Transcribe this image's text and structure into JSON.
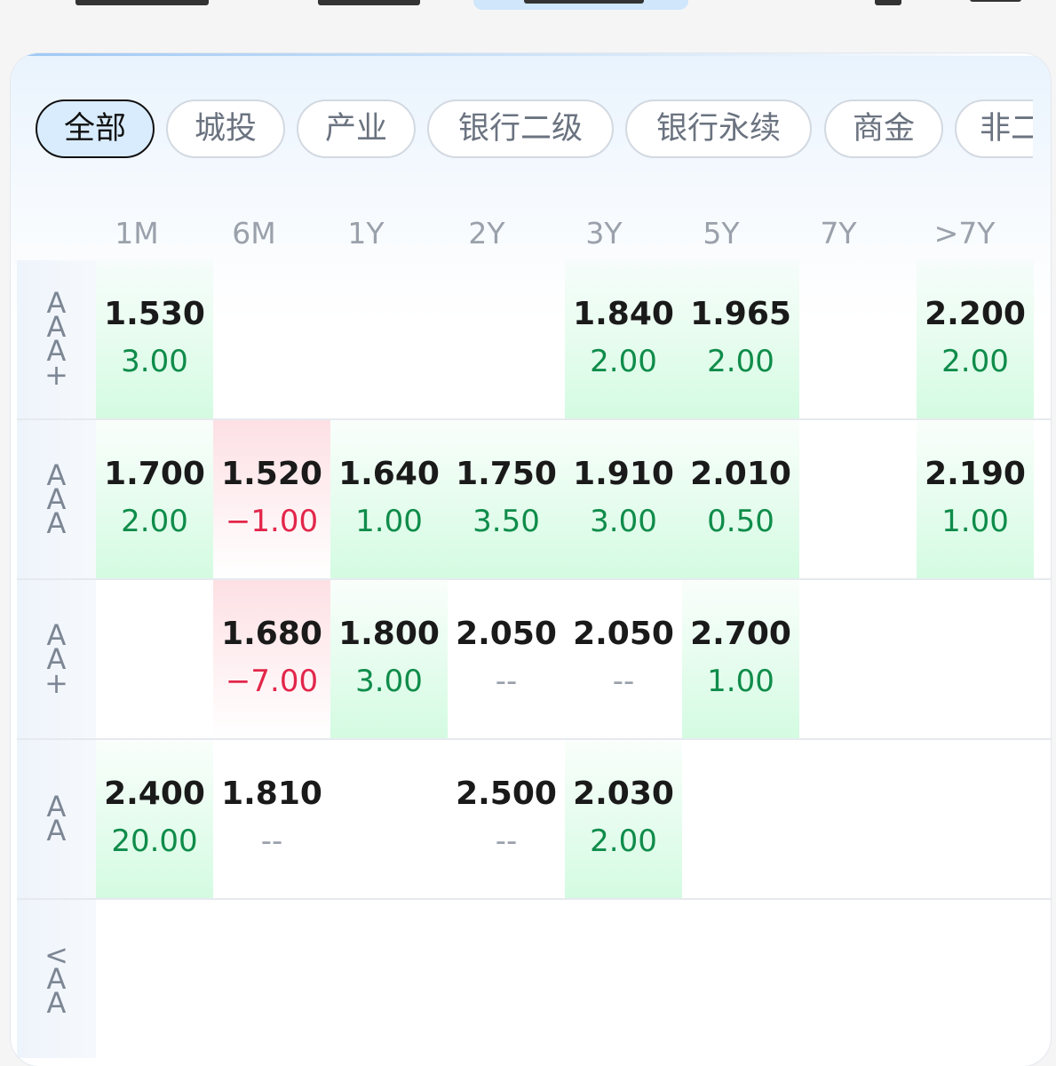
{
  "filters": [
    {
      "label": "全部",
      "active": true
    },
    {
      "label": "城投",
      "active": false
    },
    {
      "label": "产业",
      "active": false
    },
    {
      "label": "银行二级",
      "active": false
    },
    {
      "label": "银行永续",
      "active": false
    },
    {
      "label": "商金",
      "active": false
    },
    {
      "label": "非二",
      "active": false
    }
  ],
  "columns": [
    "1M",
    "6M",
    "1Y",
    "2Y",
    "3Y",
    "5Y",
    "7Y",
    ">7Y"
  ],
  "rows": [
    {
      "label": "AAA+",
      "cells": [
        {
          "rate": "1.530",
          "change": "3.00",
          "trend": "up"
        },
        null,
        null,
        null,
        {
          "rate": "1.840",
          "change": "2.00",
          "trend": "up"
        },
        {
          "rate": "1.965",
          "change": "2.00",
          "trend": "up"
        },
        null,
        {
          "rate": "2.200",
          "change": "2.00",
          "trend": "up"
        }
      ]
    },
    {
      "label": "AAA",
      "cells": [
        {
          "rate": "1.700",
          "change": "2.00",
          "trend": "up"
        },
        {
          "rate": "1.520",
          "change": "−1.00",
          "trend": "down"
        },
        {
          "rate": "1.640",
          "change": "1.00",
          "trend": "up"
        },
        {
          "rate": "1.750",
          "change": "3.50",
          "trend": "up"
        },
        {
          "rate": "1.910",
          "change": "3.00",
          "trend": "up"
        },
        {
          "rate": "2.010",
          "change": "0.50",
          "trend": "up"
        },
        null,
        {
          "rate": "2.190",
          "change": "1.00",
          "trend": "up"
        }
      ]
    },
    {
      "label": "AA+",
      "cells": [
        null,
        {
          "rate": "1.680",
          "change": "−7.00",
          "trend": "down"
        },
        {
          "rate": "1.800",
          "change": "3.00",
          "trend": "up"
        },
        {
          "rate": "2.050",
          "change": "--",
          "trend": "none"
        },
        {
          "rate": "2.050",
          "change": "--",
          "trend": "none"
        },
        {
          "rate": "2.700",
          "change": "1.00",
          "trend": "up"
        },
        null,
        null
      ]
    },
    {
      "label": "AA",
      "cells": [
        {
          "rate": "2.400",
          "change": "20.00",
          "trend": "up"
        },
        {
          "rate": "1.810",
          "change": "--",
          "trend": "none"
        },
        null,
        {
          "rate": "2.500",
          "change": "--",
          "trend": "none"
        },
        {
          "rate": "2.030",
          "change": "2.00",
          "trend": "up"
        },
        null,
        null,
        null
      ]
    },
    {
      "label": "<AA",
      "cells": [
        null,
        null,
        null,
        null,
        null,
        null,
        null,
        null
      ]
    }
  ],
  "colors": {
    "up": "#0f8c4a",
    "down": "#e2264a",
    "none": "#9aa1ab",
    "accent": "#d9ecfd"
  }
}
